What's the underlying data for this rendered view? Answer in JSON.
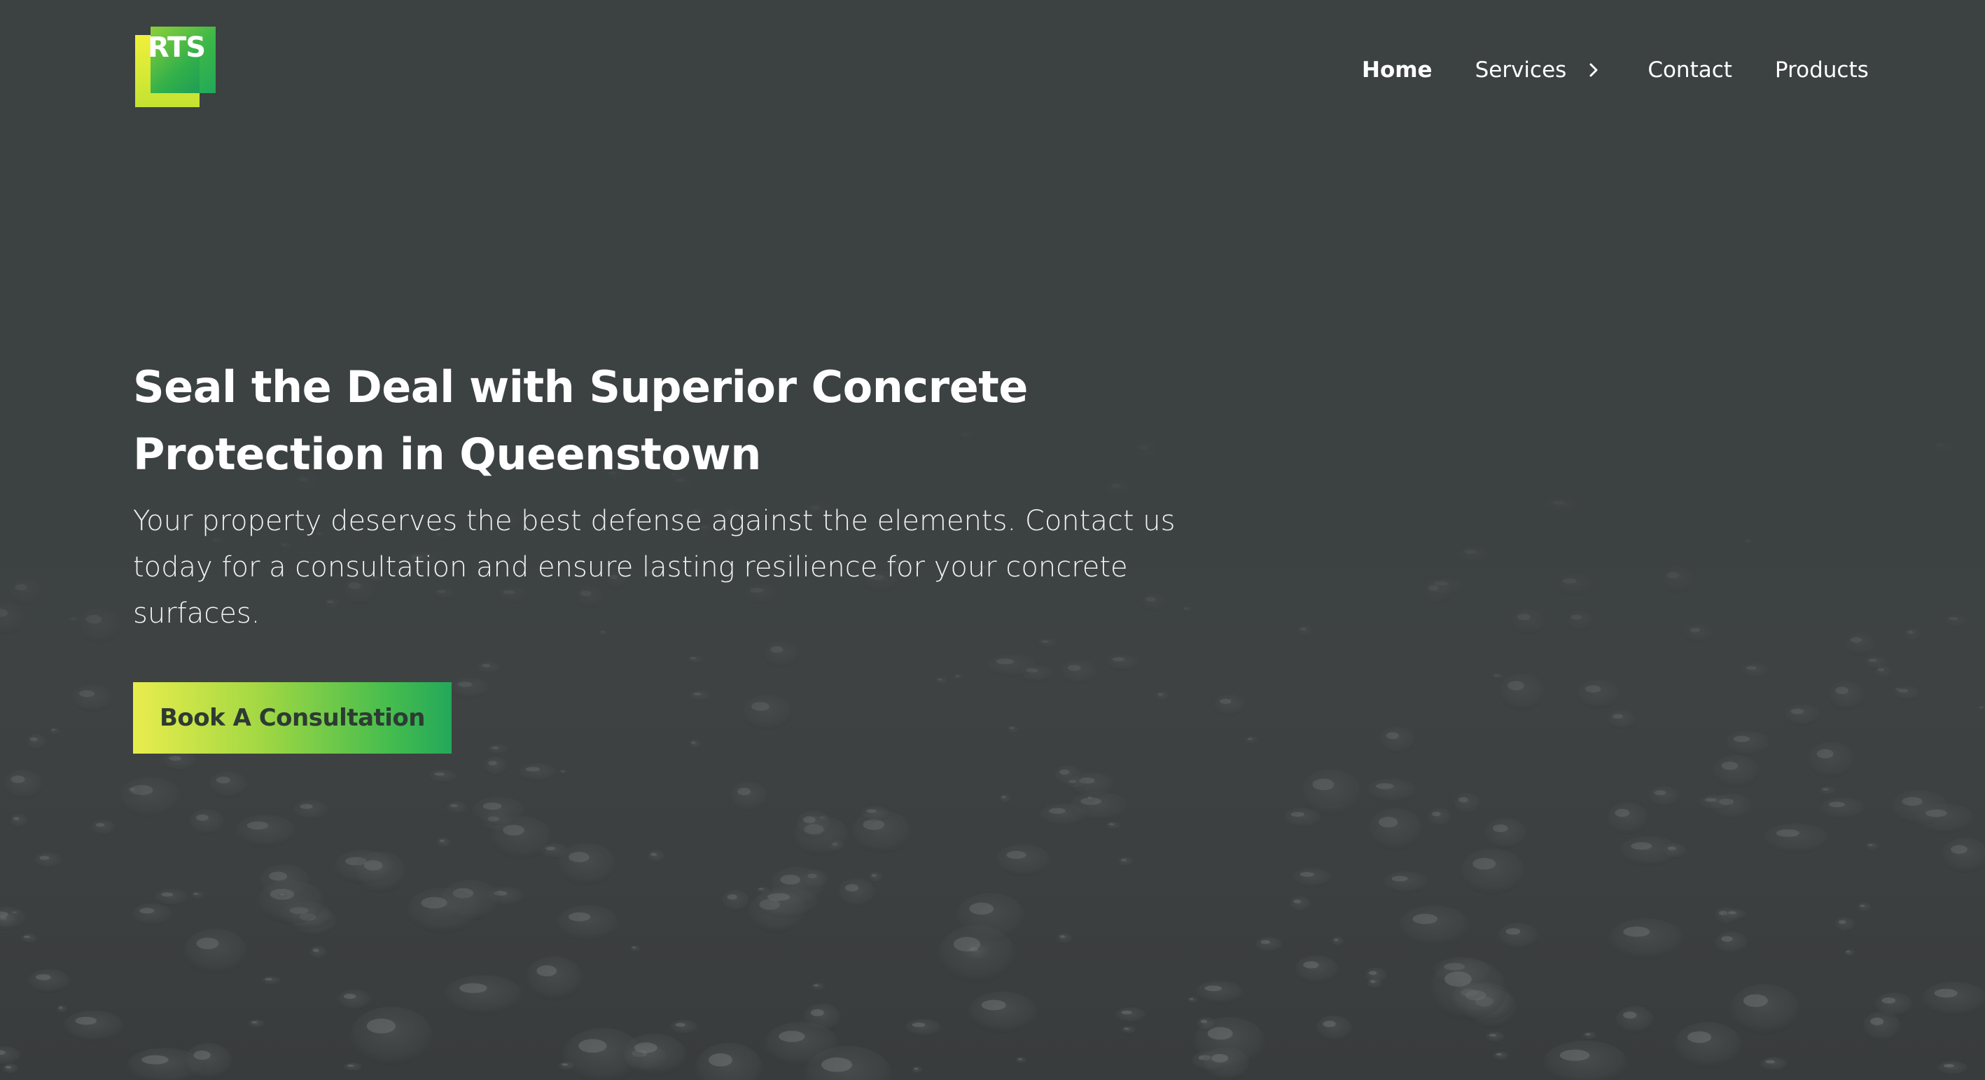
{
  "brand": {
    "logo_text": "RTS",
    "colors": {
      "accent_yellow": "#ecee3e",
      "accent_green": "#22a85a",
      "background": "#3c4142",
      "text": "#ffffff"
    }
  },
  "nav": {
    "items": [
      {
        "label": "Home",
        "active": true
      },
      {
        "label": "Services",
        "has_submenu": true,
        "icon": "chevron-right-icon"
      },
      {
        "label": "Contact"
      },
      {
        "label": "Products"
      }
    ]
  },
  "hero": {
    "title": "Seal the Deal with Superior Concrete Protection in Queenstown",
    "subtitle": "Your property deserves the best defense against the elements. Contact us today for a consultation and ensure lasting resilience for your concrete surfaces.",
    "cta_label": "Book A Consultation"
  }
}
